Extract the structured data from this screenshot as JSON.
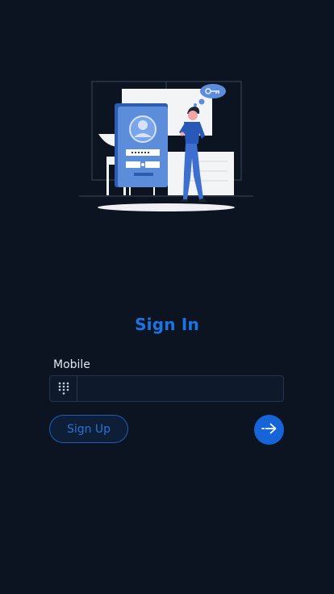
{
  "screen": {
    "title": "Sign In"
  },
  "form": {
    "mobile_label": "Mobile",
    "mobile_value": "",
    "mobile_placeholder": ""
  },
  "actions": {
    "signup_label": "Sign Up",
    "next_icon": "arrow-right-icon"
  },
  "icons": {
    "field_prefix": "dialpad-icon"
  },
  "colors": {
    "background": "#0b1420",
    "accent": "#1b74e4",
    "field_bg": "#0e1a2c",
    "field_border": "#24344f"
  }
}
